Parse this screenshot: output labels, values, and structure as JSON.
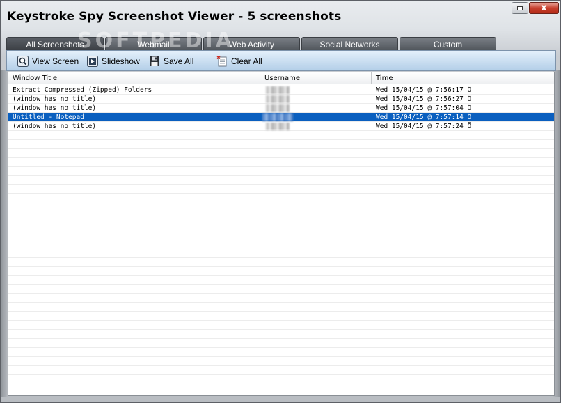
{
  "window": {
    "title": "Keystroke Spy Screenshot Viewer - 5 screenshots",
    "close_label": "x"
  },
  "watermark": "SOFTPEDIA",
  "tabs": [
    {
      "label": "All Screenshots",
      "active": true
    },
    {
      "label": "Webmail",
      "active": false
    },
    {
      "label": "Web Activity",
      "active": false
    },
    {
      "label": "Social Networks",
      "active": false
    },
    {
      "label": "Custom",
      "active": false
    }
  ],
  "toolbar": {
    "view_screen": "View Screen",
    "slideshow": "Slideshow",
    "save_all": "Save All",
    "clear_all": "Clear All"
  },
  "table": {
    "columns": [
      "Window Title",
      "Username",
      "Time"
    ],
    "rows": [
      {
        "title": "Extract Compressed (Zipped) Folders",
        "time": "Wed  15/04/15 @ 7:56:17 Õ",
        "selected": false
      },
      {
        "title": "(window has no title)",
        "time": "Wed  15/04/15 @ 7:56:27 Õ",
        "selected": false
      },
      {
        "title": "(window has no title)",
        "time": "Wed  15/04/15 @ 7:57:04 Õ",
        "selected": false
      },
      {
        "title": "Untitled - Notepad",
        "time": "Wed  15/04/15 @ 7:57:14 Õ",
        "selected": true
      },
      {
        "title": "(window has no title)",
        "time": "Wed  15/04/15 @ 7:57:24 Õ",
        "selected": false
      }
    ]
  },
  "colors": {
    "selection": "#0a5fbf",
    "tab_bg": "#4f545a",
    "toolbar_bg": "#b4cfe8"
  }
}
